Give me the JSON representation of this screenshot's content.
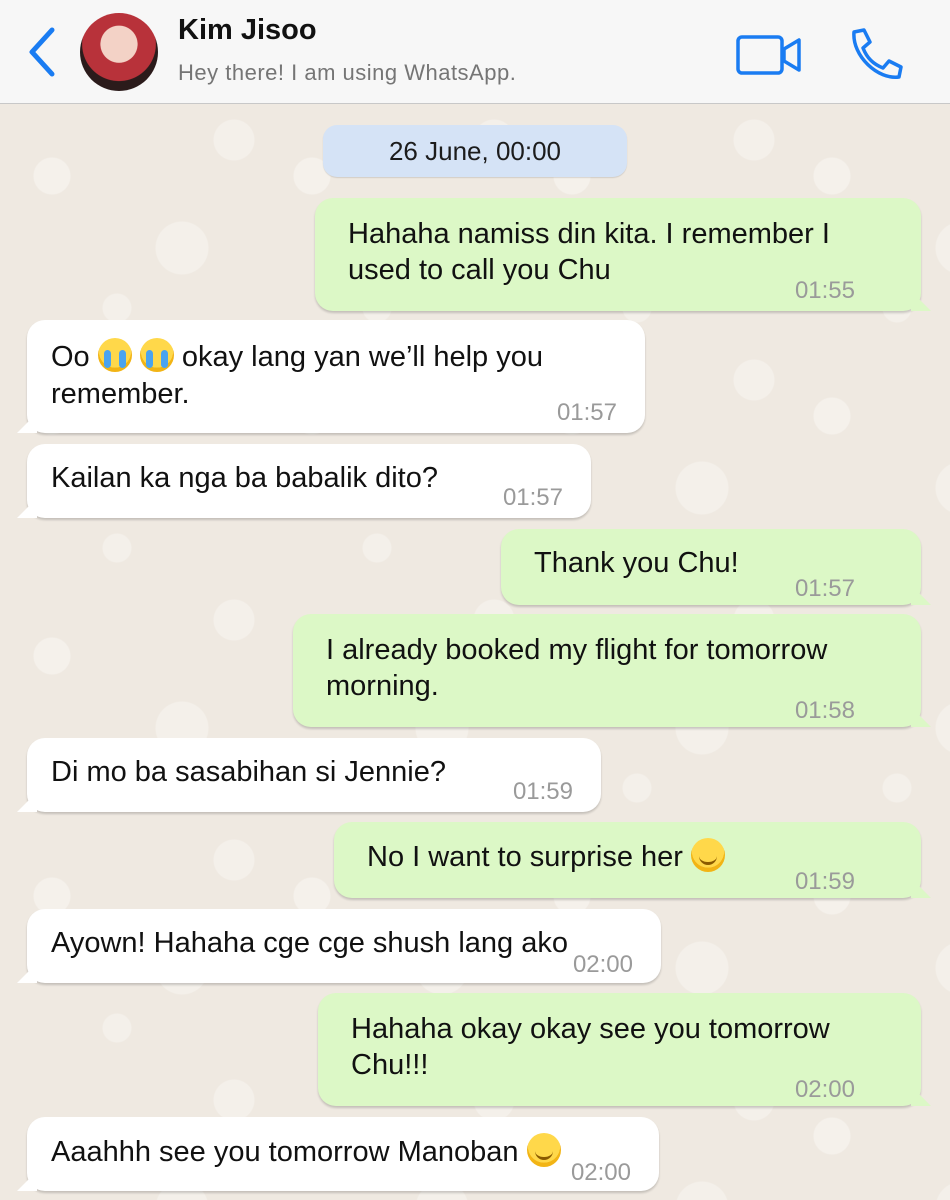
{
  "header": {
    "contact_name": "Kim Jisoo",
    "contact_status": "Hey there! I am using WhatsApp.",
    "back_icon": "chevron-left-icon",
    "video_icon": "video-camera-icon",
    "phone_icon": "phone-icon"
  },
  "date_chip": "26 June, 00:00",
  "messages": [
    {
      "direction": "out",
      "line1": "Hahaha namiss din kita. I remember I",
      "line2": "used to call you Chu",
      "time": "01:55"
    },
    {
      "direction": "in",
      "line1_a": "Oo ",
      "line1_b": " okay lang yan we’ll help you",
      "line2": "remember.",
      "emoji": "loudly-crying-face",
      "time": "01:57"
    },
    {
      "direction": "in",
      "line1": "Kailan ka nga ba babalik dito?",
      "time": "01:57"
    },
    {
      "direction": "out",
      "line1": "Thank you Chu!",
      "time": "01:57"
    },
    {
      "direction": "out",
      "line1": "I already booked my flight for tomorrow",
      "line2": "morning.",
      "time": "01:58"
    },
    {
      "direction": "in",
      "line1": "Di mo ba sasabihan si Jennie?",
      "time": "01:59"
    },
    {
      "direction": "out",
      "line1": "No I want to surprise her ",
      "emoji": "smiling-face",
      "time": "01:59"
    },
    {
      "direction": "in",
      "line1": "Ayown! Hahaha cge cge shush lang ako",
      "time": "02:00"
    },
    {
      "direction": "out",
      "line1": "Hahaha okay okay see you tomorrow",
      "line2": "Chu!!!",
      "time": "02:00"
    },
    {
      "direction": "in",
      "line1": "Aaahhh see you tomorrow Manoban ",
      "emoji": "winking-face",
      "time": "02:00"
    }
  ],
  "colors": {
    "outgoing_bubble": "#dcf8c6",
    "incoming_bubble": "#ffffff",
    "accent_blue": "#1a7cf2",
    "date_chip": "#d5e3f6"
  }
}
